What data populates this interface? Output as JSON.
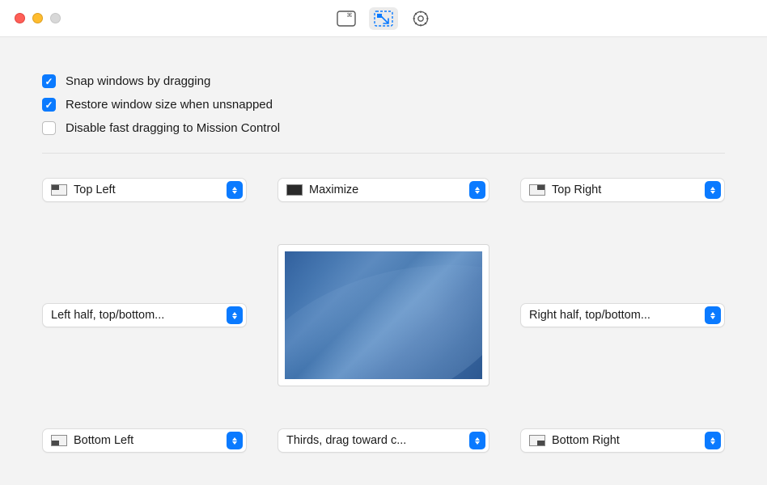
{
  "toolbar": {
    "tabs": [
      "keyboard",
      "snap",
      "settings"
    ],
    "selected": "snap"
  },
  "checkboxes": {
    "snap_dragging": {
      "label": "Snap windows by dragging",
      "checked": true
    },
    "restore_size": {
      "label": "Restore window size when unsnapped",
      "checked": true
    },
    "disable_fast": {
      "label": "Disable fast dragging to Mission Control",
      "checked": false
    }
  },
  "zones": {
    "top_left": {
      "label": "Top Left",
      "icon": "tl-q"
    },
    "top_center": {
      "label": "Maximize",
      "icon": "full"
    },
    "top_right": {
      "label": "Top Right",
      "icon": "tr-q"
    },
    "mid_left": {
      "label": "Left half, top/bottom...",
      "icon": null
    },
    "mid_right": {
      "label": "Right half, top/bottom...",
      "icon": null
    },
    "bot_left": {
      "label": "Bottom Left",
      "icon": "bl-q"
    },
    "bot_center": {
      "label": "Thirds, drag toward c...",
      "icon": null
    },
    "bot_right": {
      "label": "Bottom Right",
      "icon": "br-q"
    }
  }
}
